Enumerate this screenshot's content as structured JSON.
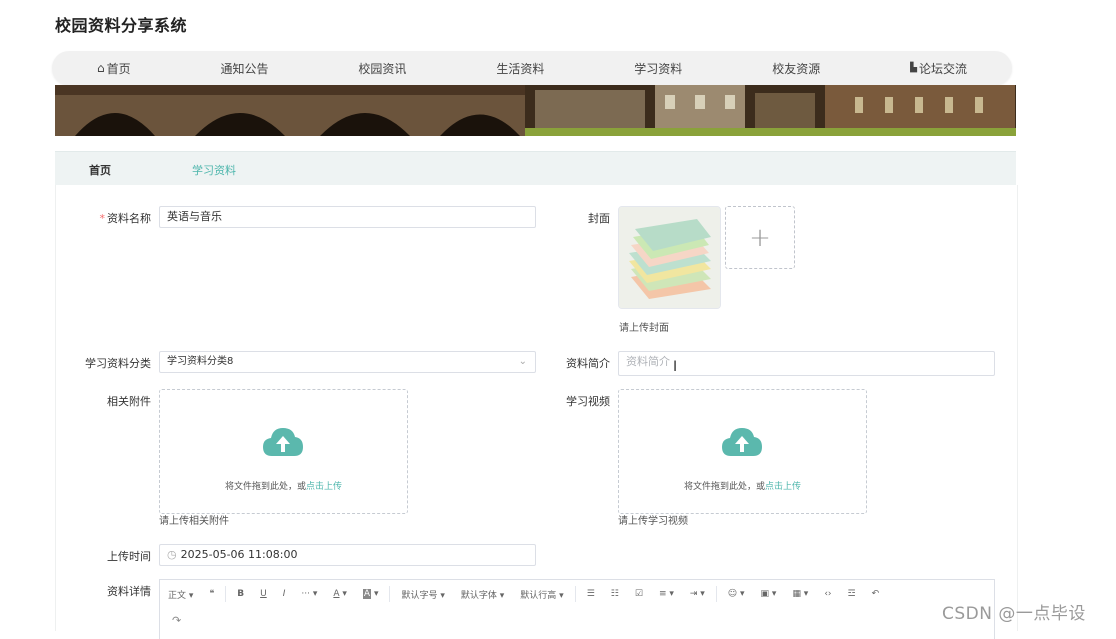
{
  "site_title": "校园资料分享系统",
  "nav": [
    {
      "label": "首页",
      "icon": "home-icon"
    },
    {
      "label": "通知公告"
    },
    {
      "label": "校园资讯"
    },
    {
      "label": "生活资料"
    },
    {
      "label": "学习资料"
    },
    {
      "label": "校友资源"
    },
    {
      "label": "论坛交流",
      "icon": "forum-icon"
    }
  ],
  "breadcrumb": {
    "home": "首页",
    "current": "学习资料"
  },
  "form": {
    "name_label": "资料名称",
    "name_required": "*",
    "name_value": "英语与音乐",
    "cover_label": "封面",
    "cover_hint": "请上传封面",
    "category_label": "学习资料分类",
    "category_value": "学习资料分类8",
    "intro_label": "资料简介",
    "intro_placeholder": "资料简介",
    "attachment_label": "相关附件",
    "attachment_hint": "请上传相关附件",
    "video_label": "学习视频",
    "video_hint": "请上传学习视频",
    "dropzone_text": "将文件拖到此处，或",
    "dropzone_link": "点击上传",
    "upload_time_label": "上传时间",
    "upload_time_value": "2025-05-06 11:08:00",
    "detail_label": "资料详情"
  },
  "editor_toolbar": {
    "paragraph": "正文",
    "quote": "❝",
    "bold": "B",
    "underline": "U",
    "italic": "I",
    "more": "···",
    "font_color": "A",
    "bg_color": "A",
    "font_size": "默认字号",
    "font_family": "默认字体",
    "line_height": "默认行高"
  },
  "watermark": "CSDN @一点毕设",
  "colors": {
    "accent": "#4db6ac",
    "required": "#f56c6c",
    "breadcrumb_bg": "#eef3f3"
  }
}
